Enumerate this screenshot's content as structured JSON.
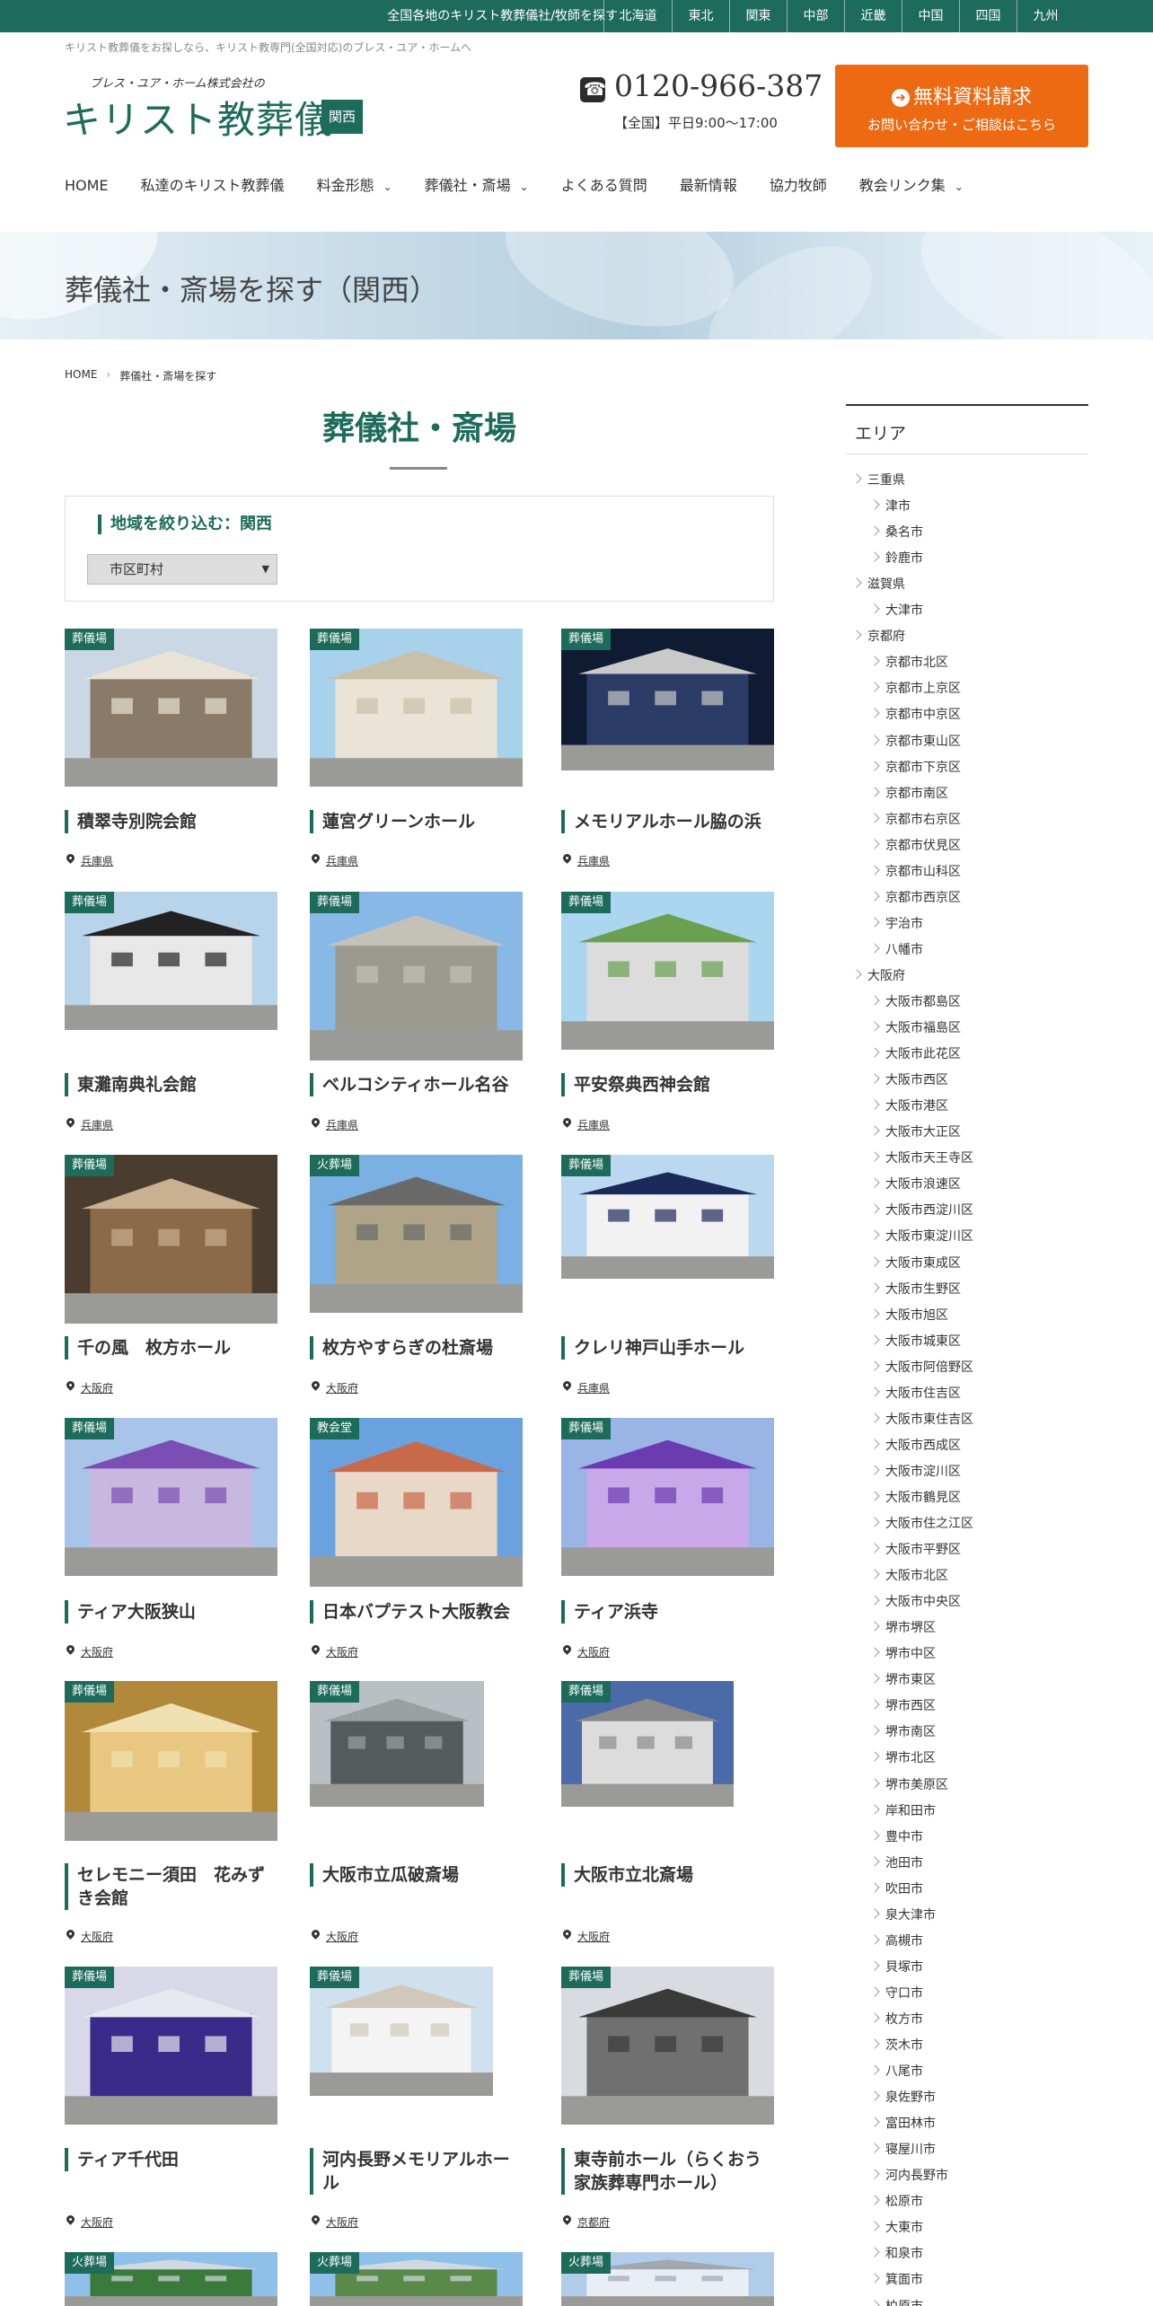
{
  "topbar": {
    "message": "全国各地のキリスト教葬儀社/牧師を探す",
    "regions": [
      "北海道",
      "東北",
      "関東",
      "中部",
      "近畿",
      "中国",
      "四国",
      "九州"
    ]
  },
  "header": {
    "tagline": "キリスト教葬儀をお探しなら、キリスト教専門(全国対応)のブレス・ユア・ホームへ",
    "logo_sub": "ブレス・ユア・ホーム株式会社の",
    "logo_main": "キリスト教葬儀",
    "logo_badge": "関西",
    "phone": "0120-966-387",
    "hours": "【全国】平日9:00〜17:00",
    "cta_title": "無料資料請求",
    "cta_sub": "お問い合わせ・ご相談はこちら"
  },
  "nav": [
    {
      "label": "HOME",
      "dropdown": false
    },
    {
      "label": "私達のキリスト教葬儀",
      "dropdown": false
    },
    {
      "label": "料金形態",
      "dropdown": true
    },
    {
      "label": "葬儀社・斎場",
      "dropdown": true
    },
    {
      "label": "よくある質問",
      "dropdown": false
    },
    {
      "label": "最新情報",
      "dropdown": false
    },
    {
      "label": "協力牧師",
      "dropdown": false
    },
    {
      "label": "教会リンク集",
      "dropdown": true
    }
  ],
  "hero": {
    "title": "葬儀社・斎場を探す（関西）"
  },
  "breadcrumb": [
    "HOME",
    "葬儀社・斎場を探す"
  ],
  "main": {
    "title": "葬儀社・斎場",
    "filter_label": "地域を絞り込む：関西",
    "filter_select": "市区町村"
  },
  "cards": [
    {
      "tag": "葬儀場",
      "name": "積翠寺別院会館",
      "pref": "兵庫県"
    },
    {
      "tag": "葬儀場",
      "name": "蓮宮グリーンホール",
      "pref": "兵庫県"
    },
    {
      "tag": "葬儀場",
      "name": "メモリアルホール脇の浜",
      "pref": "兵庫県"
    },
    {
      "tag": "葬儀場",
      "name": "東灘南典礼会館",
      "pref": "兵庫県"
    },
    {
      "tag": "葬儀場",
      "name": "ベルコシティホール名谷",
      "pref": "兵庫県"
    },
    {
      "tag": "葬儀場",
      "name": "平安祭典西神会館",
      "pref": "兵庫県"
    },
    {
      "tag": "葬儀場",
      "name": "千の風　枚方ホール",
      "pref": "大阪府"
    },
    {
      "tag": "火葬場",
      "name": "枚方やすらぎの杜斎場",
      "pref": "大阪府"
    },
    {
      "tag": "葬儀場",
      "name": "クレリ神戸山手ホール",
      "pref": "兵庫県"
    },
    {
      "tag": "葬儀場",
      "name": "ティア大阪狭山",
      "pref": "大阪府"
    },
    {
      "tag": "教会堂",
      "name": "日本バプテスト大阪教会",
      "pref": "大阪府"
    },
    {
      "tag": "葬儀場",
      "name": "ティア浜寺",
      "pref": "大阪府"
    },
    {
      "tag": "葬儀場",
      "name": "セレモニー須田　花みずき会館",
      "pref": "大阪府"
    },
    {
      "tag": "葬儀場",
      "name": "大阪市立瓜破斎場",
      "pref": "大阪府"
    },
    {
      "tag": "葬儀場",
      "name": "大阪市立北斎場",
      "pref": "大阪府"
    },
    {
      "tag": "葬儀場",
      "name": "ティア千代田",
      "pref": "大阪府"
    },
    {
      "tag": "葬儀場",
      "name": "河内長野メモリアルホール",
      "pref": "大阪府"
    },
    {
      "tag": "葬儀場",
      "name": "東寺前ホール（らくおう家族葬専門ホール）",
      "pref": "京都府"
    },
    {
      "tag": "火葬場",
      "name": "",
      "pref": ""
    },
    {
      "tag": "火葬場",
      "name": "",
      "pref": ""
    },
    {
      "tag": "火葬場",
      "name": "",
      "pref": ""
    }
  ],
  "sidebar": {
    "title": "エリア",
    "items": [
      {
        "label": "三重県",
        "level": 0
      },
      {
        "label": "津市",
        "level": 1
      },
      {
        "label": "桑名市",
        "level": 1
      },
      {
        "label": "鈴鹿市",
        "level": 1
      },
      {
        "label": "滋賀県",
        "level": 0
      },
      {
        "label": "大津市",
        "level": 1
      },
      {
        "label": "京都府",
        "level": 0
      },
      {
        "label": "京都市北区",
        "level": 1
      },
      {
        "label": "京都市上京区",
        "level": 1
      },
      {
        "label": "京都市中京区",
        "level": 1
      },
      {
        "label": "京都市東山区",
        "level": 1
      },
      {
        "label": "京都市下京区",
        "level": 1
      },
      {
        "label": "京都市南区",
        "level": 1
      },
      {
        "label": "京都市右京区",
        "level": 1
      },
      {
        "label": "京都市伏見区",
        "level": 1
      },
      {
        "label": "京都市山科区",
        "level": 1
      },
      {
        "label": "京都市西京区",
        "level": 1
      },
      {
        "label": "宇治市",
        "level": 1
      },
      {
        "label": "八幡市",
        "level": 1
      },
      {
        "label": "大阪府",
        "level": 0
      },
      {
        "label": "大阪市都島区",
        "level": 1
      },
      {
        "label": "大阪市福島区",
        "level": 1
      },
      {
        "label": "大阪市此花区",
        "level": 1
      },
      {
        "label": "大阪市西区",
        "level": 1
      },
      {
        "label": "大阪市港区",
        "level": 1
      },
      {
        "label": "大阪市大正区",
        "level": 1
      },
      {
        "label": "大阪市天王寺区",
        "level": 1
      },
      {
        "label": "大阪市浪速区",
        "level": 1
      },
      {
        "label": "大阪市西淀川区",
        "level": 1
      },
      {
        "label": "大阪市東淀川区",
        "level": 1
      },
      {
        "label": "大阪市東成区",
        "level": 1
      },
      {
        "label": "大阪市生野区",
        "level": 1
      },
      {
        "label": "大阪市旭区",
        "level": 1
      },
      {
        "label": "大阪市城東区",
        "level": 1
      },
      {
        "label": "大阪市阿倍野区",
        "level": 1
      },
      {
        "label": "大阪市住吉区",
        "level": 1
      },
      {
        "label": "大阪市東住吉区",
        "level": 1
      },
      {
        "label": "大阪市西成区",
        "level": 1
      },
      {
        "label": "大阪市淀川区",
        "level": 1
      },
      {
        "label": "大阪市鶴見区",
        "level": 1
      },
      {
        "label": "大阪市住之江区",
        "level": 1
      },
      {
        "label": "大阪市平野区",
        "level": 1
      },
      {
        "label": "大阪市北区",
        "level": 1
      },
      {
        "label": "大阪市中央区",
        "level": 1
      },
      {
        "label": "堺市堺区",
        "level": 1
      },
      {
        "label": "堺市中区",
        "level": 1
      },
      {
        "label": "堺市東区",
        "level": 1
      },
      {
        "label": "堺市西区",
        "level": 1
      },
      {
        "label": "堺市南区",
        "level": 1
      },
      {
        "label": "堺市北区",
        "level": 1
      },
      {
        "label": "堺市美原区",
        "level": 1
      },
      {
        "label": "岸和田市",
        "level": 1
      },
      {
        "label": "豊中市",
        "level": 1
      },
      {
        "label": "池田市",
        "level": 1
      },
      {
        "label": "吹田市",
        "level": 1
      },
      {
        "label": "泉大津市",
        "level": 1
      },
      {
        "label": "高槻市",
        "level": 1
      },
      {
        "label": "貝塚市",
        "level": 1
      },
      {
        "label": "守口市",
        "level": 1
      },
      {
        "label": "枚方市",
        "level": 1
      },
      {
        "label": "茨木市",
        "level": 1
      },
      {
        "label": "八尾市",
        "level": 1
      },
      {
        "label": "泉佐野市",
        "level": 1
      },
      {
        "label": "富田林市",
        "level": 1
      },
      {
        "label": "寝屋川市",
        "level": 1
      },
      {
        "label": "河内長野市",
        "level": 1
      },
      {
        "label": "松原市",
        "level": 1
      },
      {
        "label": "大東市",
        "level": 1
      },
      {
        "label": "和泉市",
        "level": 1
      },
      {
        "label": "箕面市",
        "level": 1
      },
      {
        "label": "柏原市",
        "level": 1
      }
    ]
  },
  "colors": {
    "brand_green": "#1d6b5a",
    "cta_orange": "#ed6a12"
  },
  "icons": {
    "phone": "phone-icon",
    "pin": "map-pin-icon",
    "arrow": "arrow-right-circle-icon",
    "chevron": "chevron-down-icon"
  }
}
